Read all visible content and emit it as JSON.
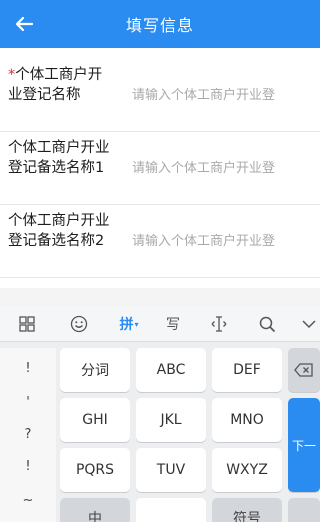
{
  "header": {
    "title": "填写信息",
    "back_icon": "arrow-left-icon",
    "color": "#2a8cf0"
  },
  "form": {
    "rows": [
      {
        "required_mark": "*",
        "label": "个体工商户开业登记名称",
        "placeholder": "请输入个体工商户开业登"
      },
      {
        "required_mark": "",
        "label": "个体工商户开业登记备选名称1",
        "placeholder": "请输入个体工商户开业登"
      },
      {
        "required_mark": "",
        "label": "个体工商户开业登记备选名称2",
        "placeholder": "请输入个体工商户开业登"
      }
    ]
  },
  "keyboard": {
    "toolbar": {
      "grid_icon": "grid-icon",
      "emoji_icon": "smiley-icon",
      "pinyin_label": "拼",
      "pinyin_caret": "▾",
      "handwrite_label": "写",
      "cursor_icon": "text-cursor-icon",
      "search_icon": "search-icon",
      "collapse_icon": "chevron-down-icon"
    },
    "symbols": [
      "!",
      "'",
      "?",
      "!",
      "~"
    ],
    "keys": {
      "row1": [
        "分词",
        "ABC",
        "DEF"
      ],
      "row2": [
        "GHI",
        "JKL",
        "MNO"
      ],
      "row3": [
        "PQRS",
        "TUV",
        "WXYZ"
      ],
      "row4": [
        "中",
        "",
        "符号"
      ],
      "delete_icon": "backspace-icon",
      "next_label": "下一"
    }
  }
}
